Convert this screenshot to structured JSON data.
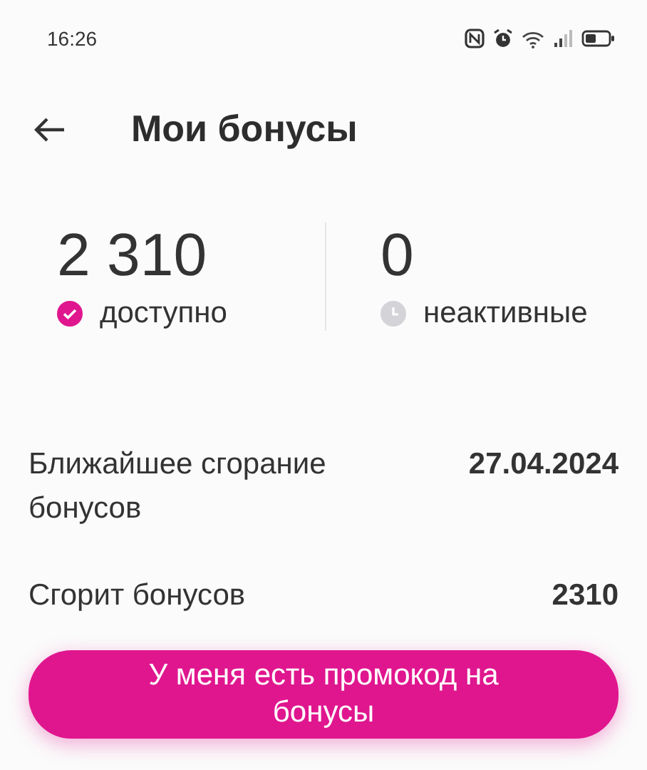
{
  "status_bar": {
    "time": "16:26"
  },
  "header": {
    "title": "Мои бонусы"
  },
  "stats": [
    {
      "value": "2 310",
      "label": "доступно",
      "kind": "available"
    },
    {
      "value": "0",
      "label": "неактивные",
      "kind": "inactive"
    }
  ],
  "details": [
    {
      "label": "Ближайшее сгорание бонусов",
      "value": "27.04.2024"
    },
    {
      "label": "Сгорит бонусов",
      "value": "2310"
    }
  ],
  "promo_button": {
    "label": "У меня есть промокод на бонусы"
  }
}
